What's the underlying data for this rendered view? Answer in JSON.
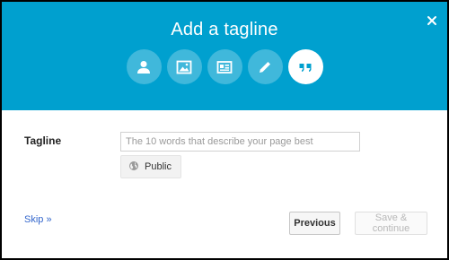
{
  "dialog": {
    "title": "Add a tagline",
    "close_icon": "close-icon",
    "steps": [
      {
        "icon": "profile-photo-icon",
        "active": false
      },
      {
        "icon": "cover-photo-icon",
        "active": false
      },
      {
        "icon": "about-card-icon",
        "active": false
      },
      {
        "icon": "pencil-icon",
        "active": false
      },
      {
        "icon": "quote-icon",
        "active": true
      }
    ]
  },
  "form": {
    "tagline_label": "Tagline",
    "tagline_value": "",
    "tagline_placeholder": "The 10 words that describe your page best",
    "visibility_label": "Public",
    "visibility_icon": "globe-icon"
  },
  "footer": {
    "skip_label": "Skip »",
    "previous_label": "Previous",
    "save_label": "Save & continue"
  },
  "colors": {
    "header_bg": "#00a0cf",
    "link": "#3366cc"
  }
}
